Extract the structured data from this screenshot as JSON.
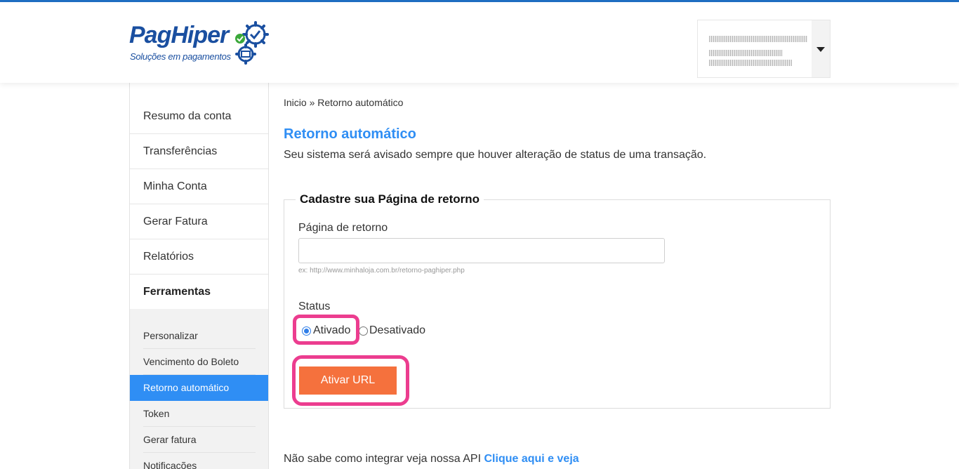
{
  "brand": {
    "name": "PagHiper",
    "tagline": "Soluções em pagamentos",
    "color": "#1a4fa0"
  },
  "account": {
    "menu_icon": "caret-down-icon"
  },
  "sidebar": {
    "items": [
      {
        "label": "Resumo da conta"
      },
      {
        "label": "Transferências"
      },
      {
        "label": "Minha Conta"
      },
      {
        "label": "Gerar Fatura"
      },
      {
        "label": "Relatórios"
      },
      {
        "label": "Ferramentas"
      }
    ],
    "sub_items": [
      {
        "label": "Personalizar"
      },
      {
        "label": "Vencimento do Boleto"
      },
      {
        "label": "Retorno automático"
      },
      {
        "label": "Token"
      },
      {
        "label": "Gerar fatura"
      },
      {
        "label": "Notificações"
      }
    ],
    "active_color": "#2f8ef4"
  },
  "breadcrumb": "Inicio » Retorno automático",
  "page": {
    "title": "Retorno automático",
    "description": "Seu sistema será avisado sempre que houver alteração de status de uma transação."
  },
  "form": {
    "legend": "Cadastre sua Página de retorno",
    "url_label": "Página de retorno",
    "url_value": "",
    "url_hint": "ex: http://www.minhaloja.com.br/retorno-paghiper.php",
    "status_label": "Status",
    "status_options": [
      {
        "label": "Ativado",
        "checked": true
      },
      {
        "label": "Desativado",
        "checked": false
      }
    ],
    "submit_label": "Ativar URL",
    "submit_color": "#f5713d",
    "highlight_color": "#ec3d8f"
  },
  "footer_note": {
    "text": "Não sabe como integrar veja nossa API",
    "link": "Clique aqui e veja"
  }
}
